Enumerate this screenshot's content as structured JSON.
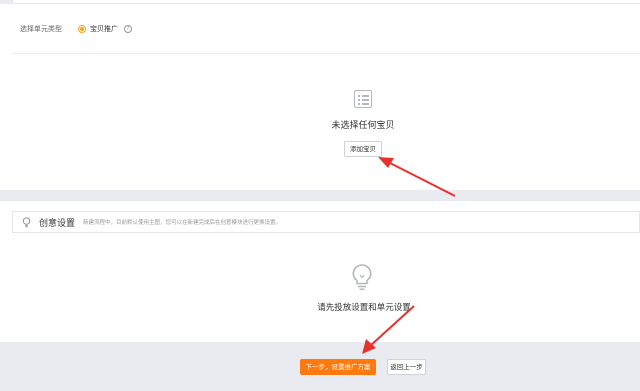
{
  "unit_type": {
    "label": "选择单元类型",
    "option": "宝贝推广",
    "help_icon": "question-circle-icon"
  },
  "empty_state": {
    "icon": "list-icon",
    "title": "未选择任何宝贝",
    "add_button": "添加宝贝"
  },
  "creative": {
    "icon": "lightbulb-icon",
    "title": "创意设置",
    "note": "新建流程中，目前默认使用主图，您可以在新建完成后在创意模块进行更换设置。"
  },
  "pending": {
    "icon": "lightbulb-icon",
    "text": "请先投放设置和单元设置"
  },
  "footer": {
    "next_button": "下一步，设置推广方案",
    "back_button": "返回上一步"
  },
  "colors": {
    "accent": "#ff7a0e",
    "radio": "#f5a623",
    "annotation_arrow": "#e8322d",
    "band": "#e9ebf0"
  }
}
